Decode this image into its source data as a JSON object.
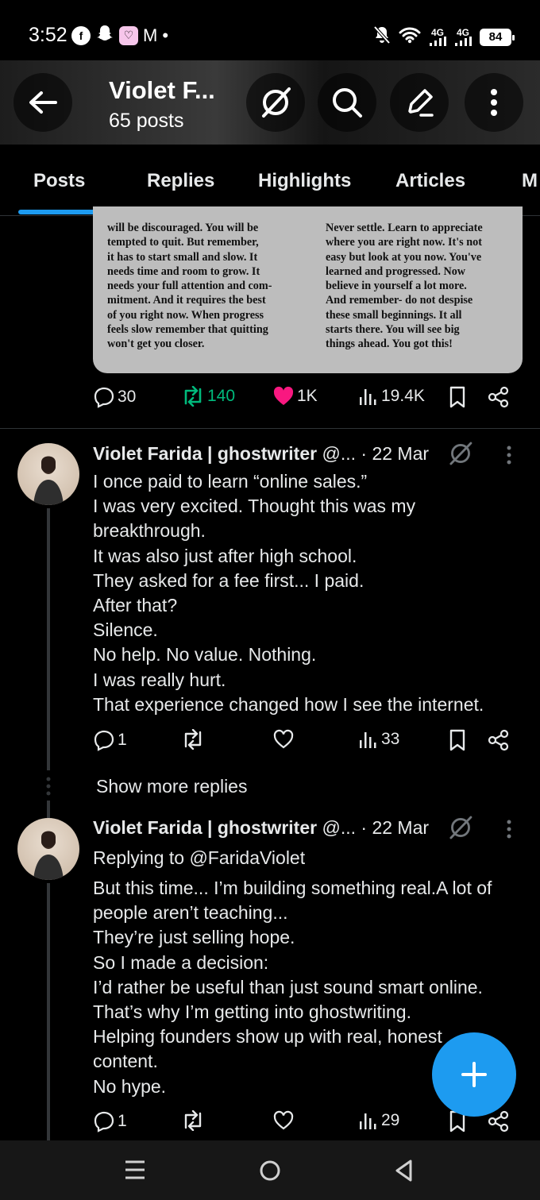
{
  "status_bar": {
    "time": "3:52",
    "app_icons": [
      "f",
      "s",
      "♡"
    ],
    "mail_glyph": "M",
    "dot": "•",
    "net1": "4G",
    "net2": "4G",
    "battery": "84"
  },
  "header": {
    "title": "Violet F...",
    "subtitle": "65 posts"
  },
  "tabs": [
    "Posts",
    "Replies",
    "Highlights",
    "Articles",
    "M"
  ],
  "image_card": {
    "left_text": "will be discouraged. You will be\ntempted to quit. But remember,\nit has to start small and slow. It\nneeds time and room to grow. It\nneeds your full attention and com-\nmitment. And it requires the best\nof you right now. When progress\nfeels slow remember that quitting\nwon't get you closer.",
    "right_text": "Never settle. Learn to appreciate\nwhere you are right now. It's not\neasy but look at you now. You've\nlearned and progressed. Now\nbelieve in yourself a lot more.\nAnd remember- do not despise\nthese small beginnings. It all\nstarts there. You will see big\nthings ahead. You got this!"
  },
  "top_actions": {
    "replies": "30",
    "reposts": "140",
    "likes": "1K",
    "views": "19.4K"
  },
  "tweets": [
    {
      "name": "Violet Farida | ghostwriter",
      "handle": "@...",
      "date": "· 22 Mar",
      "lines": [
        "I once paid to learn “online sales.”",
        "I was very excited. Thought this was my",
        "breakthrough.",
        "It was also just after high school.",
        "They asked for a fee first... I paid.",
        "After that?",
        "Silence.",
        "No help. No value. Nothing.",
        "I was really hurt.",
        "That experience changed how I see the internet."
      ],
      "replies": "1",
      "views": "33"
    },
    {
      "name": "Violet Farida | ghostwriter",
      "handle": "@...",
      "date": "· 22 Mar",
      "replying_to": "Replying to @FaridaViolet",
      "lines": [
        "But this time... I’m building something real.A lot of",
        "people aren’t teaching...",
        "They’re just selling hope.",
        "So I made a decision:",
        "I’d rather be useful than just sound smart online.",
        "That’s why I’m getting into ghostwriting.",
        "Helping founders show up with real, honest",
        "content.",
        "No hype."
      ],
      "replies": "1",
      "views": "29"
    }
  ],
  "show_more": "Show more replies",
  "colors": {
    "accent": "#1d9bf0",
    "like": "#f91880",
    "repost": "#00ba7c"
  }
}
